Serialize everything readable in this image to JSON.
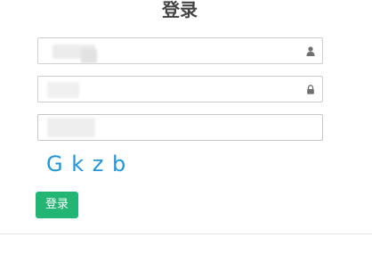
{
  "page": {
    "title": "登录"
  },
  "form": {
    "username": {
      "value": "",
      "icon": "user-icon"
    },
    "password": {
      "value": "",
      "icon": "lock-icon"
    },
    "captcha_input": {
      "value": ""
    },
    "captcha_text": "G k z b",
    "submit_label": "登录"
  },
  "colors": {
    "accent": "#22b573",
    "captcha": "#2196d9",
    "border": "#cfcfcf"
  }
}
